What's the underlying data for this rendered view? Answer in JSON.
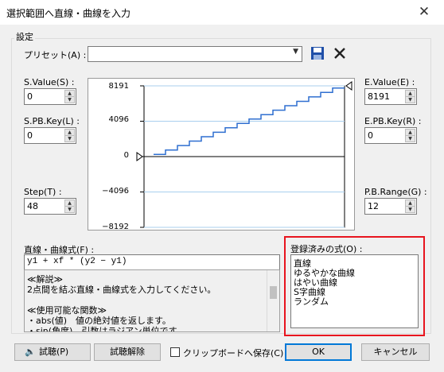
{
  "window": {
    "title": "選択範囲へ直線・曲線を入力"
  },
  "settings": {
    "group_label": "設定"
  },
  "preset": {
    "label": "プリセット(A) :",
    "value": ""
  },
  "svalue": {
    "label": "S.Value(S) :",
    "value": "0"
  },
  "spbkey": {
    "label": "S.PB.Key(L) :",
    "value": "0"
  },
  "step": {
    "label": "Step(T) :",
    "value": "48"
  },
  "evalue": {
    "label": "E.Value(E) :",
    "value": "8191"
  },
  "epbkey": {
    "label": "E.PB.Key(R) :",
    "value": "0"
  },
  "pbrange": {
    "label": "P.B.Range(G) :",
    "value": "12"
  },
  "graph": {
    "ticks": [
      "8191",
      "4096",
      "0",
      "−4096",
      "−8192"
    ]
  },
  "chart_data": {
    "type": "line",
    "x": [
      0,
      1
    ],
    "values": [
      0,
      8191
    ],
    "steps": 48,
    "ylim": [
      -8192,
      8191
    ],
    "yticks": [
      8191,
      4096,
      0,
      -4096,
      -8192
    ]
  },
  "formula": {
    "label": "直線・曲線式(F) :",
    "value": "y1 + xf * (y2 − y1)"
  },
  "description": {
    "lines": [
      "≪解説≫",
      "2点間を結ぶ直線・曲線式を入力してください。",
      "",
      "≪使用可能な関数≫",
      "・abs(値)　値の絶対値を返します。",
      "・sin(角度)　引数はラジアン単位です"
    ]
  },
  "registered": {
    "label": "登録済みの式(O) :",
    "items": [
      "直線",
      "ゆるやかな曲線",
      "はやい曲線",
      "S字曲線",
      "ランダム"
    ]
  },
  "buttons": {
    "audition": "試聴(P)",
    "audition_cancel": "試聴解除",
    "save_clipboard": "クリップボードへ保存(C)",
    "ok": "OK",
    "cancel": "キャンセル"
  },
  "colors": {
    "highlight": "#e8141e",
    "graph_line": "#2f6fd0",
    "ok_border": "#0078d7"
  }
}
